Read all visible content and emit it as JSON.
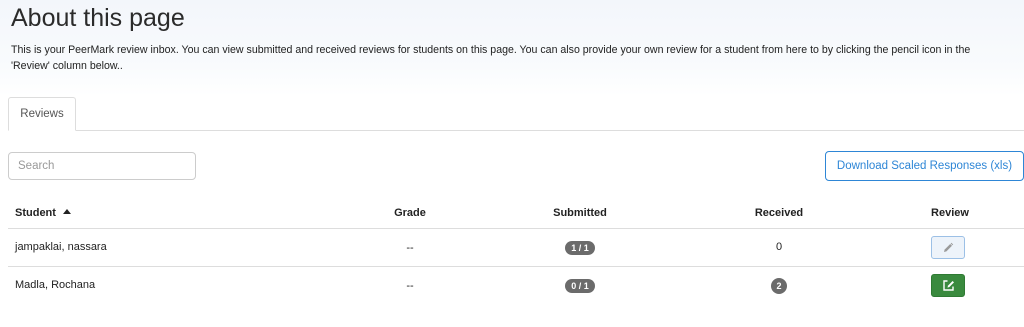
{
  "header": {
    "title": "About this page",
    "intro": "This is your PeerMark review inbox. You can view submitted and received reviews for students on this page. You can also provide your own review for a student from here to by clicking the pencil icon in the 'Review' column below.."
  },
  "tabs": [
    {
      "label": "Reviews",
      "active": true
    }
  ],
  "search": {
    "placeholder": "Search",
    "value": ""
  },
  "download_button": {
    "label": "Download Scaled Responses (xls)"
  },
  "table": {
    "columns": {
      "student": "Student",
      "grade": "Grade",
      "submitted": "Submitted",
      "received": "Received",
      "review": "Review"
    },
    "sort": {
      "column": "Student",
      "direction": "ascending"
    },
    "rows": [
      {
        "student": "jampaklai, nassara",
        "grade": "--",
        "submitted": "1 / 1",
        "received": "0",
        "review_icon": "pencil-icon",
        "review_style": "light"
      },
      {
        "student": "Madla, Rochana",
        "grade": "--",
        "submitted": "0 / 1",
        "received": "2",
        "review_icon": "edit-square-icon",
        "review_style": "green"
      }
    ]
  },
  "colors": {
    "accent": "#2e86d6",
    "badge": "#6b6b6b",
    "review_green": "#3a8a3e"
  }
}
